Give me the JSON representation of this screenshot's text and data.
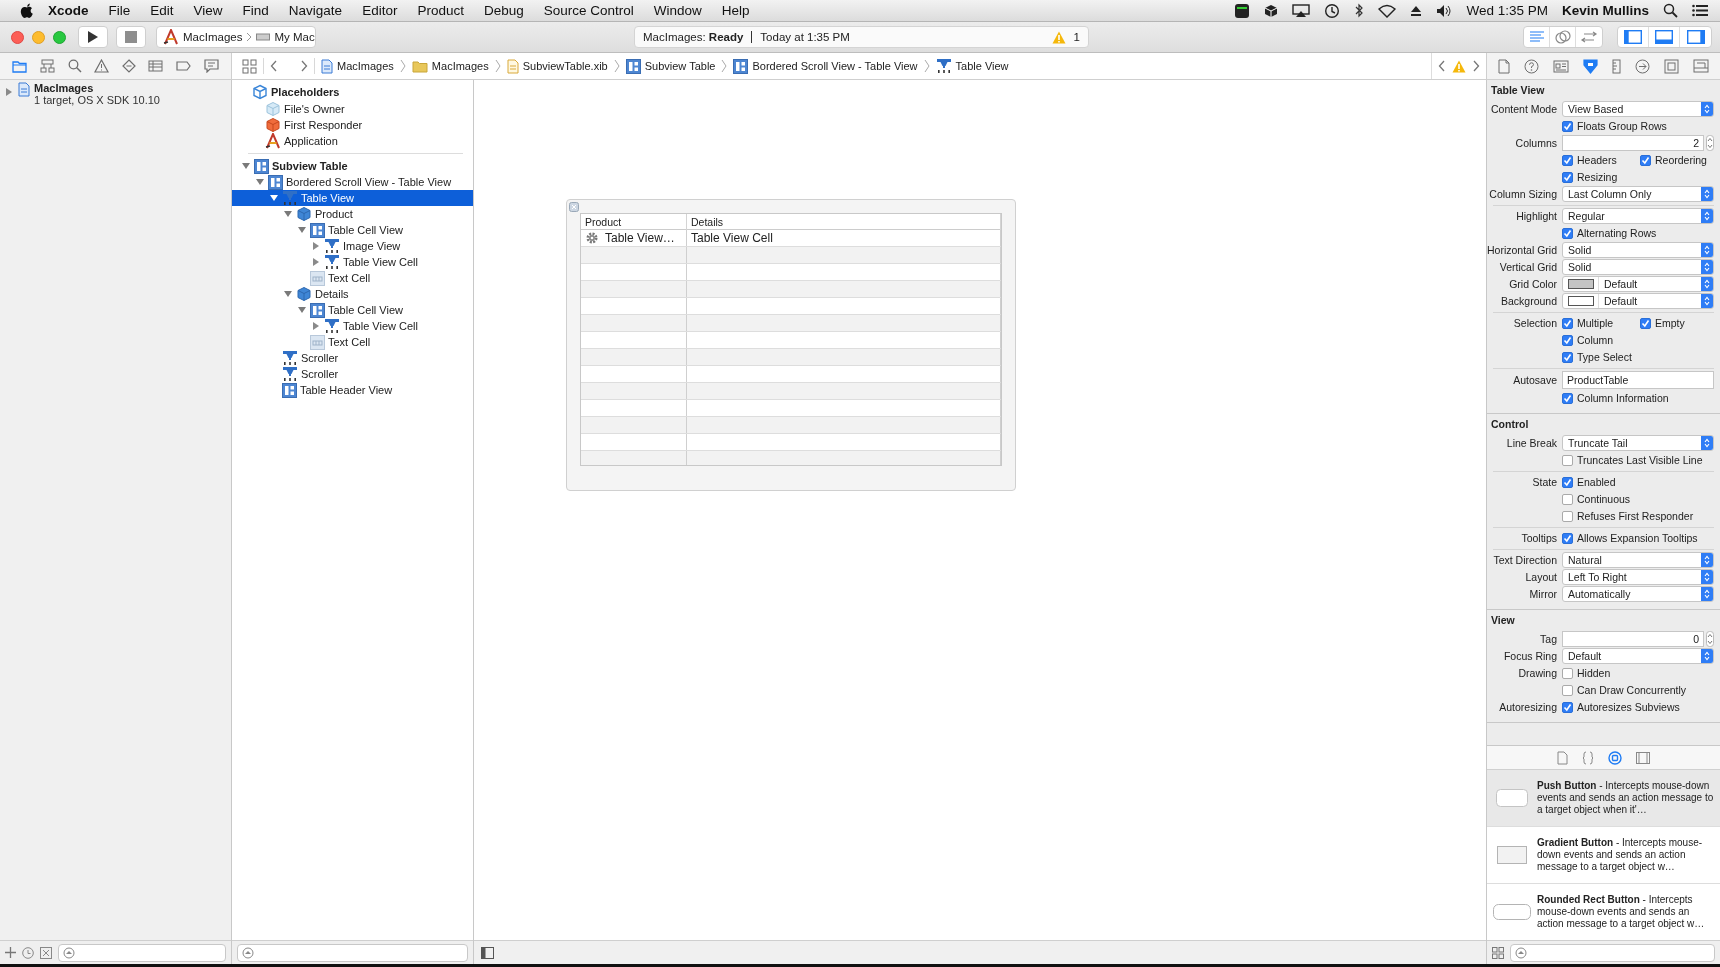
{
  "menu_bar": {
    "app": "Xcode",
    "items": [
      "File",
      "Edit",
      "View",
      "Find",
      "Navigate",
      "Editor",
      "Product",
      "Debug",
      "Source Control",
      "Window",
      "Help"
    ],
    "clock": "Wed 1:35 PM",
    "user": "Kevin Mullins"
  },
  "toolbar": {
    "scheme": "MacImages",
    "destination": "My Mac",
    "activity": "MacImages: **Ready**",
    "activity_time": "Today at 1:35 PM",
    "warning_count": "1",
    "editor_modes": [
      {
        "selected": true
      },
      {
        "selected": false
      },
      {
        "selected": false
      }
    ],
    "panels": [
      {
        "on": true
      },
      {
        "on": true
      },
      {
        "on": true
      }
    ]
  },
  "navigator_tabs": [
    {
      "selected": true
    },
    {
      "selected": false
    },
    {
      "selected": false
    },
    {
      "selected": false
    },
    {
      "selected": false
    },
    {
      "selected": false
    },
    {
      "selected": false
    },
    {
      "selected": false
    }
  ],
  "jump_bar": [
    {
      "label": "MacImages",
      "kind": "project"
    },
    {
      "label": "MacImages",
      "kind": "folder"
    },
    {
      "label": "SubviewTable.xib",
      "kind": "xib"
    },
    {
      "label": "Subview Table",
      "kind": "view"
    },
    {
      "label": "Bordered Scroll View - Table View",
      "kind": "view"
    },
    {
      "label": "Table View",
      "kind": "control"
    }
  ],
  "inspector_tabs": [
    {
      "selected": false
    },
    {
      "selected": false
    },
    {
      "selected": false
    },
    {
      "selected": true
    },
    {
      "selected": false
    },
    {
      "selected": false
    },
    {
      "selected": false
    },
    {
      "selected": false
    }
  ],
  "navigator": {
    "project": {
      "name": "MacImages",
      "subtitle": "1 target, OS X SDK 10.10",
      "expanded": false
    }
  },
  "outline": {
    "placeholders": {
      "title": "Placeholders",
      "items": [
        {
          "label": "File's Owner",
          "kind": "owner"
        },
        {
          "label": "First Responder",
          "kind": "responder"
        },
        {
          "label": "Application",
          "kind": "application"
        }
      ]
    },
    "objects": [
      {
        "label": "Subview Table",
        "kind": "view",
        "expanded": true,
        "selected": false,
        "children": [
          {
            "label": "Bordered Scroll View - Table View",
            "kind": "view",
            "expanded": true,
            "selected": false,
            "children": [
              {
                "label": "Table View",
                "kind": "control",
                "expanded": true,
                "selected": true,
                "children": [
                  {
                    "label": "Product",
                    "kind": "column",
                    "expanded": true,
                    "selected": false,
                    "children": [
                      {
                        "label": "Table Cell View",
                        "kind": "view",
                        "expanded": true,
                        "selected": false,
                        "children": [
                          {
                            "label": "Image View",
                            "kind": "control",
                            "expanded": false,
                            "selected": false
                          },
                          {
                            "label": "Table View Cell",
                            "kind": "control",
                            "expanded": false,
                            "selected": false
                          }
                        ]
                      },
                      {
                        "label": "Text Cell",
                        "kind": "cell",
                        "selected": false
                      }
                    ]
                  },
                  {
                    "label": "Details",
                    "kind": "column",
                    "expanded": true,
                    "selected": false,
                    "children": [
                      {
                        "label": "Table Cell View",
                        "kind": "view",
                        "expanded": true,
                        "selected": false,
                        "children": [
                          {
                            "label": "Table View Cell",
                            "kind": "control",
                            "expanded": false,
                            "selected": false
                          }
                        ]
                      },
                      {
                        "label": "Text Cell",
                        "kind": "cell",
                        "selected": false
                      }
                    ]
                  }
                ]
              },
              {
                "label": "Scroller",
                "kind": "control",
                "selected": false
              },
              {
                "label": "Scroller",
                "kind": "control",
                "selected": false
              },
              {
                "label": "Table Header View",
                "kind": "view",
                "selected": false
              }
            ]
          }
        ]
      }
    ]
  },
  "canvas": {
    "table": {
      "columns": [
        "Product",
        "Details"
      ],
      "rows": [
        [
          "Table View…",
          "Table View Cell"
        ]
      ]
    }
  },
  "inspector": {
    "sections": [
      {
        "title": "Table View",
        "groups": [
          [
            {
              "kind": "popup",
              "label": "Content Mode",
              "value": "View Based"
            },
            {
              "kind": "checks",
              "items": [
                {
                  "text": "Floats Group Rows",
                  "checked": true
                }
              ]
            },
            {
              "kind": "stepper",
              "label": "Columns",
              "value": "2"
            },
            {
              "kind": "checks",
              "items": [
                {
                  "text": "Headers",
                  "checked": true
                },
                {
                  "text": "Reordering",
                  "checked": true
                }
              ]
            },
            {
              "kind": "checks",
              "items": [
                {
                  "text": "Resizing",
                  "checked": true
                }
              ]
            },
            {
              "kind": "popup",
              "label": "Column Sizing",
              "value": "Last Column Only"
            }
          ],
          [
            {
              "kind": "popup",
              "label": "Highlight",
              "value": "Regular"
            },
            {
              "kind": "checks",
              "items": [
                {
                  "text": "Alternating Rows",
                  "checked": true
                }
              ]
            },
            {
              "kind": "popup",
              "label": "Horizontal Grid",
              "value": "Solid"
            },
            {
              "kind": "popup",
              "label": "Vertical Grid",
              "value": "Solid"
            },
            {
              "kind": "color",
              "label": "Grid Color",
              "value": "Default",
              "color": "#c4c4c4"
            },
            {
              "kind": "color",
              "label": "Background",
              "value": "Default",
              "color": "#ffffff"
            }
          ],
          [
            {
              "kind": "checks",
              "label": "Selection",
              "items": [
                {
                  "text": "Multiple",
                  "checked": true
                },
                {
                  "text": "Empty",
                  "checked": true
                }
              ]
            },
            {
              "kind": "checks",
              "items": [
                {
                  "text": "Column",
                  "checked": true
                }
              ]
            },
            {
              "kind": "checks",
              "items": [
                {
                  "text": "Type Select",
                  "checked": true
                }
              ]
            }
          ],
          [
            {
              "kind": "text",
              "label": "Autosave",
              "value": "ProductTable"
            },
            {
              "kind": "checks",
              "items": [
                {
                  "text": "Column Information",
                  "checked": true
                }
              ]
            }
          ]
        ]
      },
      {
        "title": "Control",
        "groups": [
          [
            {
              "kind": "popup",
              "label": "Line Break",
              "value": "Truncate Tail"
            },
            {
              "kind": "checks",
              "items": [
                {
                  "text": "Truncates Last Visible Line",
                  "checked": false
                }
              ]
            }
          ],
          [
            {
              "kind": "checks",
              "label": "State",
              "items": [
                {
                  "text": "Enabled",
                  "checked": true
                }
              ]
            },
            {
              "kind": "checks",
              "items": [
                {
                  "text": "Continuous",
                  "checked": false
                }
              ]
            },
            {
              "kind": "checks",
              "items": [
                {
                  "text": "Refuses First Responder",
                  "checked": false
                }
              ]
            }
          ],
          [
            {
              "kind": "checks",
              "label": "Tooltips",
              "items": [
                {
                  "text": "Allows Expansion Tooltips",
                  "checked": true
                }
              ]
            }
          ],
          [
            {
              "kind": "popup",
              "label": "Text Direction",
              "value": "Natural"
            },
            {
              "kind": "popup",
              "label": "Layout",
              "value": "Left To Right"
            },
            {
              "kind": "popup",
              "label": "Mirror",
              "value": "Automatically"
            }
          ]
        ]
      },
      {
        "title": "View",
        "groups": [
          [
            {
              "kind": "stepper",
              "label": "Tag",
              "value": "0"
            },
            {
              "kind": "popup",
              "label": "Focus Ring",
              "value": "Default"
            },
            {
              "kind": "checks",
              "label": "Drawing",
              "items": [
                {
                  "text": "Hidden",
                  "checked": false
                }
              ]
            },
            {
              "kind": "checks",
              "items": [
                {
                  "text": "Can Draw Concurrently",
                  "checked": false
                }
              ]
            },
            {
              "kind": "checks",
              "label": "Autoresizing",
              "items": [
                {
                  "text": "Autoresizes Subviews",
                  "checked": true
                }
              ]
            }
          ]
        ]
      }
    ]
  },
  "library": {
    "tabs": [
      {
        "selected": false
      },
      {
        "selected": false
      },
      {
        "selected": true
      },
      {
        "selected": false
      }
    ],
    "items": [
      {
        "kind": "push",
        "text": "**Push Button** - Intercepts mouse-down events and sends an action message to a target object when it'…",
        "selected": true
      },
      {
        "kind": "gradient",
        "text": "**Gradient Button** - Intercepts mouse-down events and sends an action message to a target object w…",
        "selected": false
      },
      {
        "kind": "rounded",
        "text": "**Rounded Rect Button** - Intercepts mouse-down events and sends an action message to a target object w…",
        "selected": false
      }
    ]
  }
}
